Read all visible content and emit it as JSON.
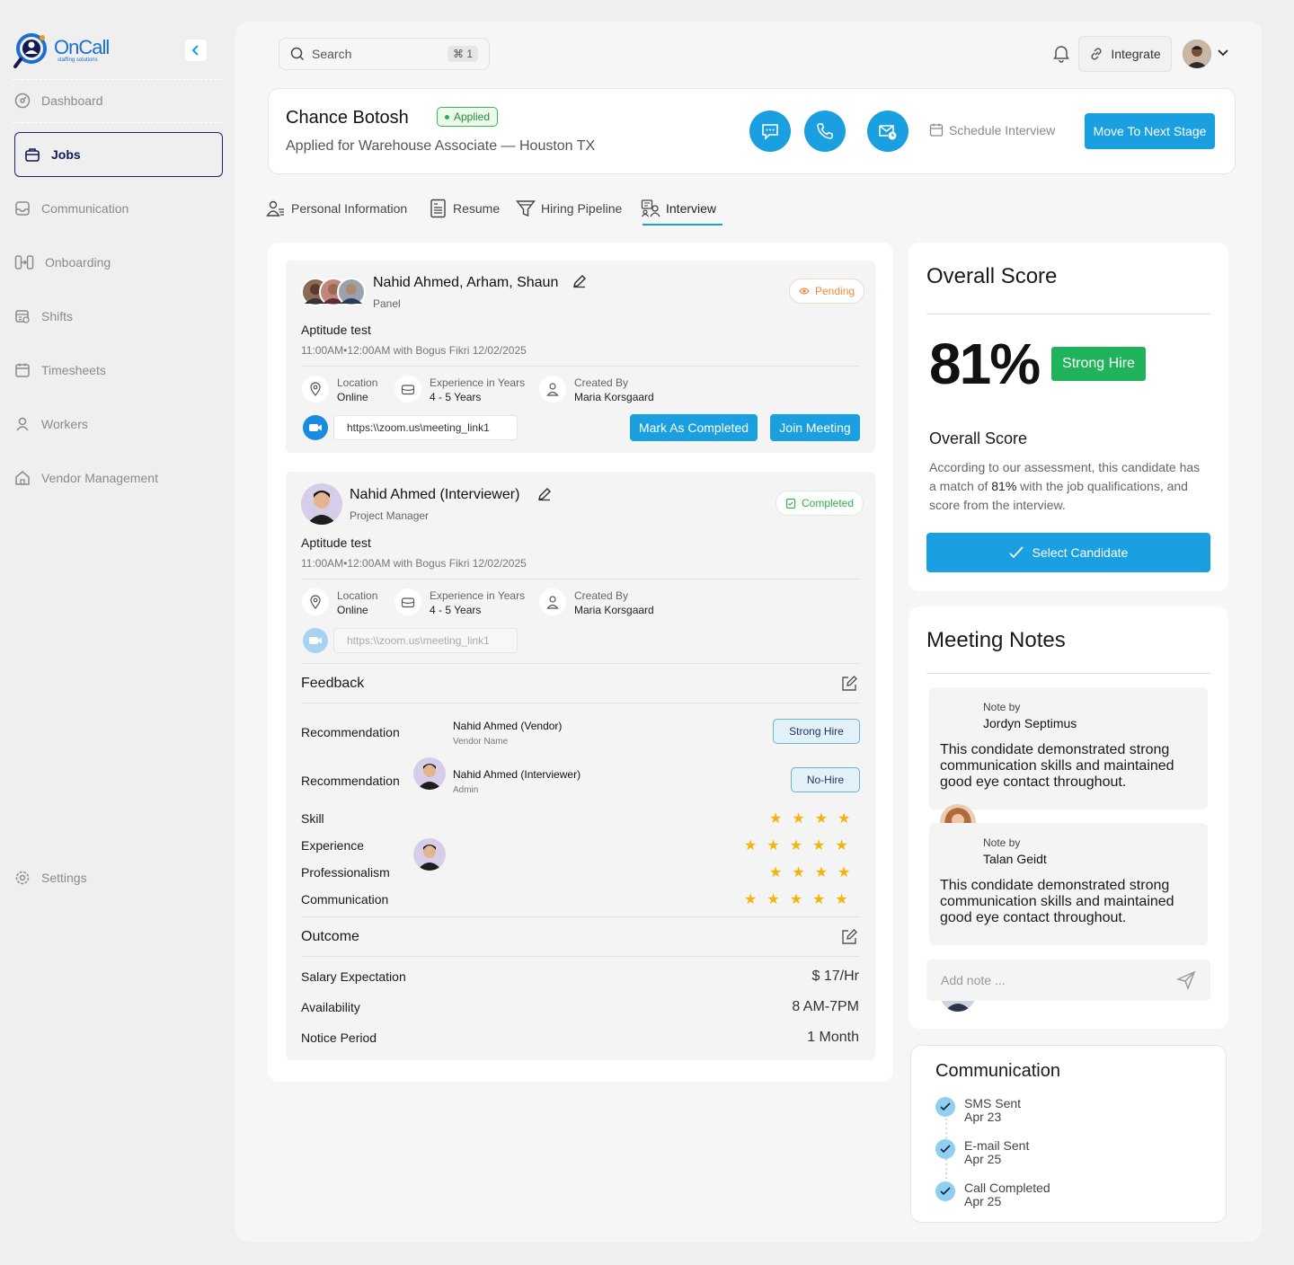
{
  "brand": {
    "name": "OnCall",
    "tagline": "staffing solutions",
    "color": "#1c6fd1"
  },
  "sidebar": {
    "items": [
      {
        "label": "Dashboard",
        "icon": "dashboard-icon"
      },
      {
        "label": "Jobs",
        "icon": "briefcase-icon",
        "active": true
      },
      {
        "label": "Communication",
        "icon": "inbox-icon"
      },
      {
        "label": "Onboarding",
        "icon": "onboarding-icon"
      },
      {
        "label": "Shifts",
        "icon": "shifts-icon"
      },
      {
        "label": "Timesheets",
        "icon": "calendar-icon"
      },
      {
        "label": "Workers",
        "icon": "user-icon"
      },
      {
        "label": "Vendor Management",
        "icon": "home-icon"
      }
    ],
    "settings": "Settings"
  },
  "topbar": {
    "search_placeholder": "Search",
    "shortcut": "⌘ 1",
    "integrate": "Integrate"
  },
  "candidate": {
    "name": "Chance Botosh",
    "status": "Applied",
    "applied_for": "Applied for Warehouse Associate — Houston TX",
    "schedule": "Schedule Interview",
    "next_stage": "Move To Next Stage"
  },
  "tabs": [
    {
      "label": "Personal Information"
    },
    {
      "label": "Resume"
    },
    {
      "label": "Hiring Pipeline"
    },
    {
      "label": "Interview",
      "active": true
    }
  ],
  "interviews": [
    {
      "name": "Nahid Ahmed, Arham, Shaun",
      "role": "Panel",
      "status": "Pending",
      "title": "Aptitude test",
      "time": "11:00AM•12:00AM  with Bogus Fikri 12/02/2025",
      "location_label": "Location",
      "location": "Online",
      "exp_label": "Experience in Years",
      "exp": "4 - 5 Years",
      "created_label": "Created By",
      "created": "Maria Korsgaard",
      "link": "https:\\\\zoom.us\\meeting_link1",
      "mark_completed": "Mark As Completed",
      "join": "Join Meeting"
    },
    {
      "name": "Nahid Ahmed (Interviewer)",
      "role": "Project Manager",
      "status": "Completed",
      "title": "Aptitude test",
      "time": "11:00AM•12:00AM  with Bogus Fikri 12/02/2025",
      "location_label": "Location",
      "location": "Online",
      "exp_label": "Experience in Years",
      "exp": "4 - 5 Years",
      "created_label": "Created By",
      "created": "Maria Korsgaard",
      "link": "https:\\\\zoom.us\\meeting_link1"
    }
  ],
  "feedback": {
    "title": "Feedback",
    "recommendations": [
      {
        "label": "Recommendation",
        "name": "Nahid Ahmed (Vendor)",
        "role": "Vendor Name",
        "verdict": "Strong Hire"
      },
      {
        "label": "Recommendation",
        "name": "Nahid Ahmed (Interviewer)",
        "role": "Admin",
        "verdict": "No-Hire"
      }
    ],
    "ratings": [
      {
        "label": "Skill",
        "stars": 4
      },
      {
        "label": "Experience",
        "stars": 5
      },
      {
        "label": "Professionalism",
        "stars": 4
      },
      {
        "label": "Communication",
        "stars": 5
      }
    ]
  },
  "outcome": {
    "title": "Outcome",
    "rows": [
      {
        "label": "Salary Expectation",
        "value": "$ 17/Hr"
      },
      {
        "label": "Availability",
        "value": "8 AM-7PM"
      },
      {
        "label": "Notice Period",
        "value": "1 Month"
      }
    ]
  },
  "score": {
    "title": "Overall Score",
    "value": "81%",
    "badge": "Strong Hire",
    "subtitle": "Overall Score",
    "desc_pre": "According to our  assessment, this candidate has a match of ",
    "desc_pct": "81%",
    "desc_post": " with the job qualifications, and score from the interview.",
    "select": "Select Candidate"
  },
  "notes": {
    "title": "Meeting Notes",
    "items": [
      {
        "by": "Note by",
        "name": "Jordyn Septimus",
        "text": "This condidate  demonstrated strong communication skills and maintained good eye contact throughout."
      },
      {
        "by": "Note by",
        "name": "Talan Geidt",
        "text": "This condidate  demonstrated strong communication skills and maintained good eye contact throughout."
      }
    ],
    "placeholder": "Add note ..."
  },
  "communication": {
    "title": "Communication",
    "items": [
      {
        "label": "SMS Sent",
        "date": "Apr 23"
      },
      {
        "label": "E-mail Sent",
        "date": "Apr 25"
      },
      {
        "label": "Call Completed",
        "date": "Apr 25"
      }
    ]
  },
  "colors": {
    "accent": "#1a9fe0",
    "success": "#1fb35b",
    "star": "#f5b40b"
  }
}
